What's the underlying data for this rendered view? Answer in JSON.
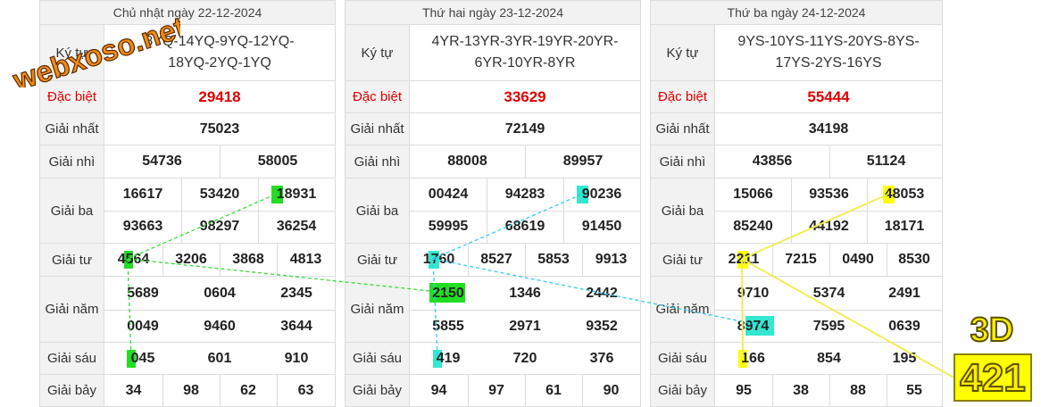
{
  "labels": {
    "kytu": "Ký tự",
    "dacbiet": "Đặc biệt",
    "nhat": "Giải nhất",
    "nhi": "Giải nhì",
    "ba": "Giải ba",
    "tu": "Giải tư",
    "nam": "Giải năm",
    "sau": "Giải sáu",
    "bay": "Giải bảy"
  },
  "days": [
    {
      "header": "Chủ nhật ngày 22-12-2024",
      "kytu": "8YQ-14YQ-9YQ-12YQ-18YQ-2YQ-1YQ",
      "kytu_lines": [
        "8YQ-14YQ-9YQ-12YQ-",
        "18YQ-2YQ-1YQ"
      ],
      "dacbiet": "29418",
      "nhat": "75023",
      "nhi": [
        "54736",
        "58005"
      ],
      "ba": [
        "16617",
        "53420",
        "18931",
        "93663",
        "98297",
        "36254"
      ],
      "tu": [
        "4564",
        "3206",
        "3868",
        "4813"
      ],
      "nam": [
        "5689",
        "0604",
        "2345",
        "0049",
        "9460",
        "3644"
      ],
      "sau": [
        "045",
        "601",
        "910"
      ],
      "bay": [
        "34",
        "98",
        "62",
        "63"
      ]
    },
    {
      "header": "Thứ hai ngày 23-12-2024",
      "kytu": "4YR-13YR-3YR-19YR-20YR-6YR-10YR-8YR",
      "kytu_lines": [
        "4YR-13YR-3YR-19YR-20YR-",
        "6YR-10YR-8YR"
      ],
      "dacbiet": "33629",
      "nhat": "72149",
      "nhi": [
        "88008",
        "89957"
      ],
      "ba": [
        "00424",
        "94283",
        "90236",
        "59995",
        "68619",
        "91450"
      ],
      "tu": [
        "1760",
        "8527",
        "5853",
        "9913"
      ],
      "nam": [
        "2150",
        "1346",
        "2442",
        "5855",
        "2971",
        "9352"
      ],
      "sau": [
        "419",
        "720",
        "376"
      ],
      "bay": [
        "94",
        "97",
        "61",
        "90"
      ]
    },
    {
      "header": "Thứ ba ngày 24-12-2024",
      "kytu": "9YS-10YS-11YS-20YS-8YS-17YS-2YS-16YS",
      "kytu_lines": [
        "9YS-10YS-11YS-20YS-8YS-",
        "17YS-2YS-16YS"
      ],
      "dacbiet": "55444",
      "nhat": "34198",
      "nhi": [
        "43856",
        "51124"
      ],
      "ba": [
        "15066",
        "93536",
        "48053",
        "85240",
        "44192",
        "18171"
      ],
      "tu": [
        "2211",
        "7215",
        "0490",
        "8530"
      ],
      "nam": [
        "9710",
        "5374",
        "2491",
        "8974",
        "7595",
        "0639"
      ],
      "sau": [
        "166",
        "854",
        "195"
      ],
      "bay": [
        "95",
        "38",
        "88",
        "55"
      ]
    }
  ],
  "logo_text": "webxoso.net",
  "badge": {
    "label": "3D",
    "number": "421"
  },
  "colors": {
    "green": "#22dd22",
    "cyan": "#33e8d0",
    "yellow": "#ffff00",
    "special": "#e00000"
  }
}
